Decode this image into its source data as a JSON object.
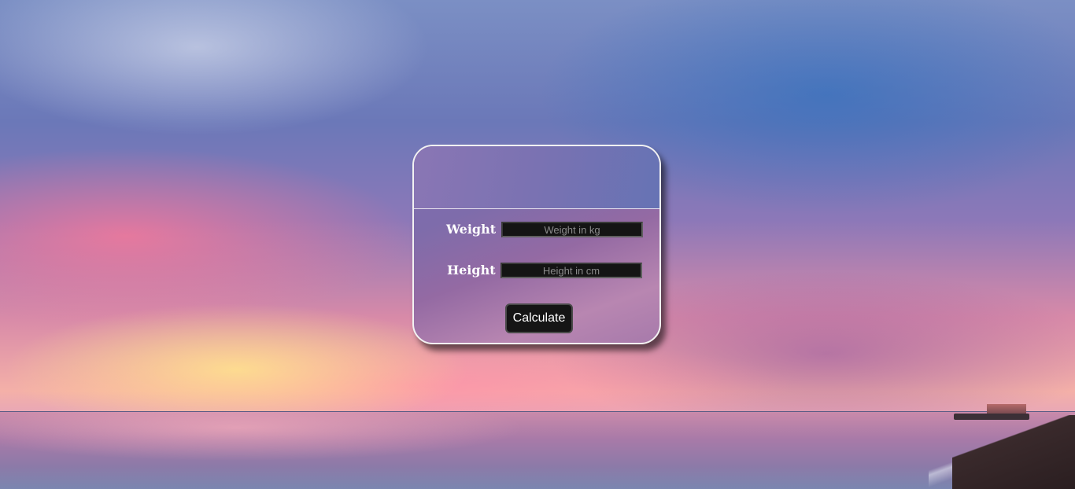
{
  "form": {
    "weight_label": "Weight",
    "weight_placeholder": "Weight in kg",
    "height_label": "Height",
    "height_placeholder": "Height in cm",
    "calculate_label": "Calculate"
  },
  "colors": {
    "card_border": "#f2f2f2",
    "input_background": "#141414",
    "button_background": "#151515"
  }
}
